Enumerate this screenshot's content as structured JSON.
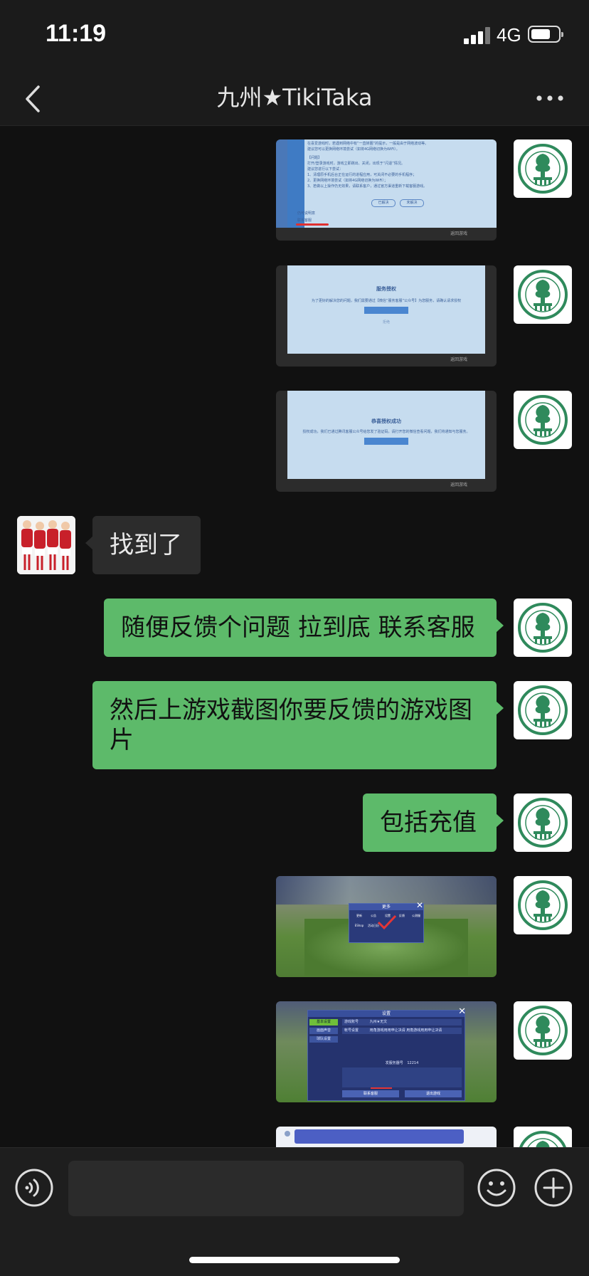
{
  "status_bar": {
    "time": "11:19",
    "network": "4G"
  },
  "nav": {
    "title": "九州★TikiTaka"
  },
  "messages": {
    "screenshot_1": {
      "lines": [
        "在喜爱游戏时，若遇到网络中有“一直转圈”的提示，一般是由于网络波动等。",
        "建议您可以更换网络环境尝试（如将4G网络切换为WiFi）。",
        "【问题】",
        "打开/登录游戏时，游戏立即跳出、关闭，出现于“闪退”情况。",
        "建议您进行以下尝试：",
        "1、清理原手机后台正在运行的进程应用，可关闭不必要的手机程序；",
        "2、更换网络环境尝试（如将4G网络切换为WiFi）；",
        "3、若做以上操作仍无效果，请联系客户，通过官方渠道重新下载客服游戏。"
      ],
      "btn_1": "已解决",
      "btn_2": "未解决",
      "link": "仍可说明意",
      "contact": "联系客服",
      "back_text": "返回游戏"
    },
    "screenshot_2": {
      "title": "服务授权",
      "text": "为了更好的解决您的问题，我们需要通过【微信“服务客服”公众号】为您服务，请确认请求授权",
      "cancel": "拒绝",
      "back_text": "返回游戏"
    },
    "screenshot_3": {
      "title": "恭喜授权成功",
      "text": "授权成功，我们已通过腾讯客服公众号给您发了验证码，请打开您的微信查看问题，我们将通知与您服务。",
      "back_text": "返回游戏"
    },
    "msg_found": "找到了",
    "msg_feedback": "随便反馈个问题 拉到底 联系客服",
    "msg_screenshot": "然后上游戏截图你要反馈的游戏图片",
    "msg_recharge": "包括充值",
    "game_1": {
      "panel_title": "更多",
      "items": [
        "更新",
        "公告",
        "设置",
        "反馈",
        "公测服",
        "EShop",
        "活动日历"
      ]
    },
    "game_2": {
      "panel_title": "设置",
      "tabs": [
        "基本设置",
        "画面声音",
        "球队设置"
      ],
      "rows": [
        {
          "label": "游戏账号",
          "value": "九州★无文"
        },
        {
          "label": "帐号设置",
          "value": "用角游戏用用申让决请 用角游戏用用申让决请"
        }
      ],
      "server_label": "发服务器号",
      "server_value": "12214",
      "btn_service": "联系客服",
      "btn_exit": "退出游戏"
    }
  },
  "colors": {
    "bubble_out": "#5dba6a",
    "bubble_in": "#2c2c2c",
    "bg": "#111111"
  }
}
